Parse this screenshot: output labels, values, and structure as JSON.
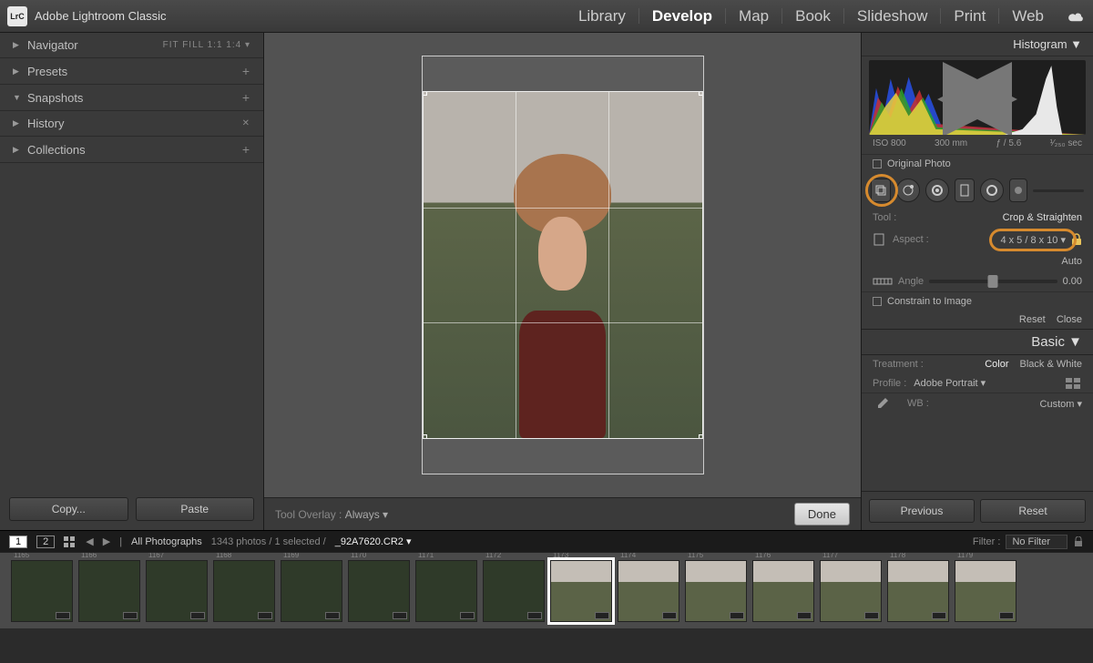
{
  "app": {
    "logo": "LrC",
    "title": "Adobe Lightroom Classic"
  },
  "modules": [
    "Library",
    "Develop",
    "Map",
    "Book",
    "Slideshow",
    "Print",
    "Web"
  ],
  "active_module": "Develop",
  "left_panels": {
    "navigator": {
      "label": "Navigator",
      "fits": "FIT  FILL  1:1   1:4 ▾"
    },
    "presets": {
      "label": "Presets",
      "action": "+"
    },
    "snapshots": {
      "label": "Snapshots",
      "action": "+"
    },
    "history": {
      "label": "History",
      "action": "✕"
    },
    "collections": {
      "label": "Collections",
      "action": "+"
    }
  },
  "left_buttons": {
    "copy": "Copy...",
    "paste": "Paste"
  },
  "center": {
    "overlay_label": "Tool Overlay :",
    "overlay_value": "Always  ▾",
    "done": "Done"
  },
  "right": {
    "histogram": "Histogram ▼",
    "meta": {
      "iso": "ISO 800",
      "focal": "300 mm",
      "aperture": "ƒ / 5.6",
      "shutter": "¹⁄₂₅₀ sec"
    },
    "original_photo": "Original Photo",
    "tool_label": "Tool :",
    "tool_name": "Crop & Straighten",
    "aspect_label": "Aspect :",
    "aspect_value": "4 x 5  /  8 x 10  ▾",
    "auto": "Auto",
    "angle_label": "Angle",
    "angle_value": "0.00",
    "constrain": "Constrain to Image",
    "reset": "Reset",
    "close": "Close",
    "basic": "Basic ▼",
    "treatment_label": "Treatment :",
    "treatment_color": "Color",
    "treatment_bw": "Black & White",
    "profile_label": "Profile :",
    "profile_value": "Adobe Portrait  ▾",
    "wb_label": "WB :",
    "wb_value": "Custom  ▾",
    "previous": "Previous",
    "reset2": "Reset"
  },
  "secondary": {
    "pages": [
      "1",
      "2"
    ],
    "collection": "All Photographs",
    "counts": "1343 photos / 1 selected /",
    "filename": "_92A7620.CR2 ▾",
    "filter_label": "Filter :",
    "filter_value": "No Filter"
  },
  "thumbs": [
    {
      "idx": "1165"
    },
    {
      "idx": "1166"
    },
    {
      "idx": "1167"
    },
    {
      "idx": "1168"
    },
    {
      "idx": "1169"
    },
    {
      "idx": "1170"
    },
    {
      "idx": "1171"
    },
    {
      "idx": "1172"
    },
    {
      "idx": "1173",
      "selected": true
    },
    {
      "idx": "1174"
    },
    {
      "idx": "1175"
    },
    {
      "idx": "1176"
    },
    {
      "idx": "1177"
    },
    {
      "idx": "1178"
    },
    {
      "idx": "1179"
    }
  ]
}
